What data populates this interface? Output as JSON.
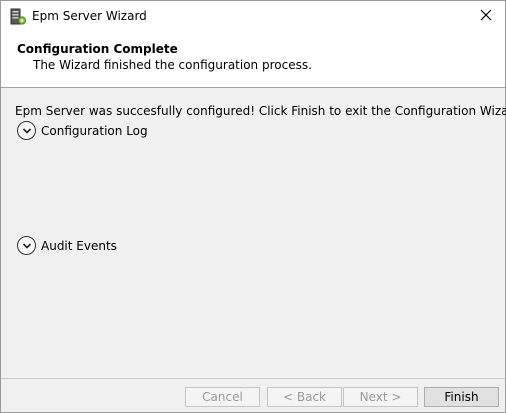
{
  "window": {
    "title": "Epm Server Wizard"
  },
  "header": {
    "title": "Configuration Complete",
    "subtitle": "The Wizard finished the configuration process."
  },
  "content": {
    "message": "Epm Server was succesfully configured! Click Finish to exit the Configuration Wizard.",
    "sections": [
      {
        "label": "Configuration Log",
        "expanded": false
      },
      {
        "label": "Audit Events",
        "expanded": false
      }
    ]
  },
  "buttons": {
    "cancel": {
      "label": "Cancel",
      "enabled": false
    },
    "back": {
      "label": "< Back",
      "enabled": false
    },
    "next": {
      "label": "Next >",
      "enabled": false
    },
    "finish": {
      "label": "Finish",
      "enabled": true
    }
  },
  "icons": {
    "app": "server-gear-icon",
    "close": "close-icon",
    "expand": "chevron-down-icon"
  }
}
